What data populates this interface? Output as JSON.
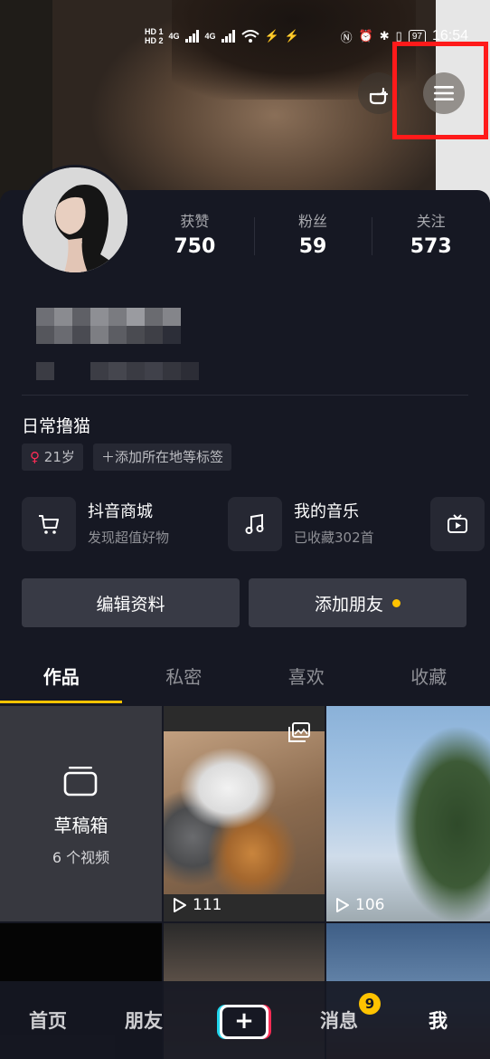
{
  "status_bar": {
    "sim1": "HD 1",
    "sim2": "HD 2",
    "net1": "4G",
    "net2": "4G",
    "battery": "97",
    "time": "16:54"
  },
  "stats": [
    {
      "label": "获赞",
      "value": "750"
    },
    {
      "label": "粉丝",
      "value": "59"
    },
    {
      "label": "关注",
      "value": "573"
    }
  ],
  "profile": {
    "bio": "日常撸猫",
    "age_tag": "21岁",
    "location_tag": "添加所在地等标签"
  },
  "services": [
    {
      "title": "抖音商城",
      "subtitle": "发现超值好物",
      "icon": "cart-icon"
    },
    {
      "title": "我的音乐",
      "subtitle": "已收藏302首",
      "icon": "music-note-icon"
    },
    {
      "title": "",
      "subtitle": "",
      "icon": "tv-icon"
    }
  ],
  "actions": {
    "edit": "编辑资料",
    "add_friend": "添加朋友"
  },
  "tabs": [
    "作品",
    "私密",
    "喜欢",
    "收藏"
  ],
  "active_tab": 0,
  "drafts": {
    "title": "草稿箱",
    "count": "6 个视频"
  },
  "videos": [
    {
      "plays": "111"
    },
    {
      "plays": "106"
    }
  ],
  "bottom_nav": {
    "home": "首页",
    "friends": "朋友",
    "plus": "+",
    "messages": "消息",
    "me": "我",
    "message_badge": "9"
  },
  "colors": {
    "background": "#161823",
    "accent_yellow": "#ffc300",
    "highlight_box": "#ff1a1a"
  }
}
